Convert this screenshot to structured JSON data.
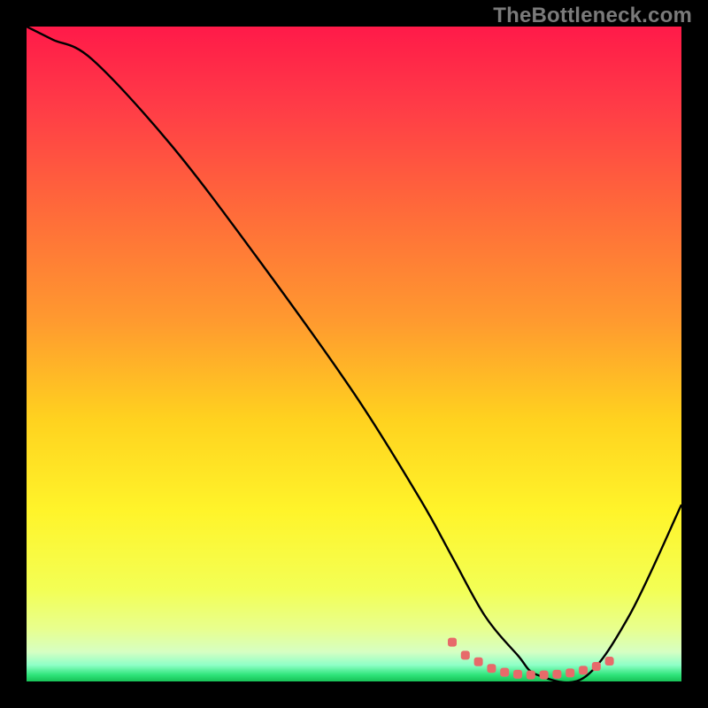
{
  "attribution": "TheBottleneck.com",
  "colors": {
    "frame": "#000000",
    "attribution_text": "#7a7a7a",
    "curve": "#000000",
    "marker": "#e76a6a",
    "gradient_stops": [
      {
        "offset": 0.0,
        "color": "#ff1a49"
      },
      {
        "offset": 0.12,
        "color": "#ff3b47"
      },
      {
        "offset": 0.28,
        "color": "#ff6a3a"
      },
      {
        "offset": 0.45,
        "color": "#ff9a2f"
      },
      {
        "offset": 0.6,
        "color": "#ffd21f"
      },
      {
        "offset": 0.74,
        "color": "#fff42a"
      },
      {
        "offset": 0.86,
        "color": "#f3ff55"
      },
      {
        "offset": 0.92,
        "color": "#e8ff8e"
      },
      {
        "offset": 0.955,
        "color": "#d6ffc3"
      },
      {
        "offset": 0.975,
        "color": "#8effc7"
      },
      {
        "offset": 0.99,
        "color": "#2fe47a"
      },
      {
        "offset": 1.0,
        "color": "#17c257"
      }
    ]
  },
  "chart_data": {
    "type": "line",
    "title": "",
    "xlabel": "",
    "ylabel": "",
    "xlim": [
      0,
      100
    ],
    "ylim": [
      0,
      100
    ],
    "grid": false,
    "legend": false,
    "series": [
      {
        "name": "bottleneck-curve",
        "x": [
          0,
          4,
          10,
          22,
          35,
          50,
          60,
          65,
          70,
          75,
          78,
          85,
          92,
          100
        ],
        "values": [
          100,
          98,
          95,
          82,
          65,
          44,
          28,
          19,
          10,
          4,
          1,
          0.5,
          10,
          27
        ]
      }
    ],
    "annotations": [
      {
        "name": "optimal-range-markers",
        "type": "scatter",
        "x": [
          65,
          67,
          69,
          71,
          73,
          75,
          77,
          79,
          81,
          83,
          85,
          87,
          89
        ],
        "values": [
          6,
          4,
          3,
          2,
          1.4,
          1.1,
          1,
          1,
          1.1,
          1.3,
          1.7,
          2.3,
          3.1
        ]
      }
    ]
  }
}
